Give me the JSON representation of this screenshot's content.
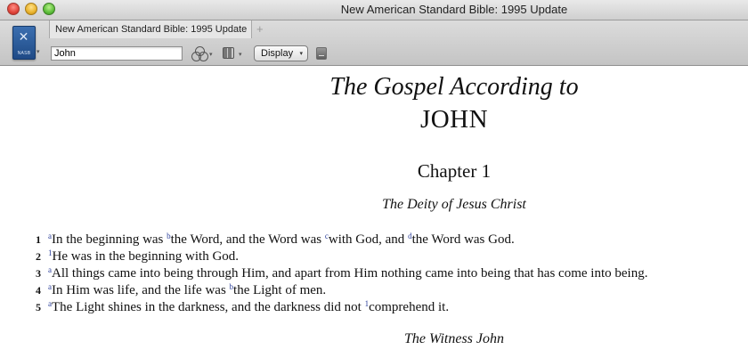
{
  "window": {
    "title": "New American Standard Bible: 1995 Update"
  },
  "toolbar": {
    "book_icon_abbr": "NASB",
    "tab_label": "New American Standard Bible: 1995 Update",
    "tab_add": "+",
    "reference_value": "John",
    "display_label": "Display",
    "caret": "▾"
  },
  "content": {
    "subtitle": "The Gospel According to",
    "book_title": "JOHN",
    "chapter": "Chapter 1",
    "section_heading": "The Deity of Jesus Christ",
    "next_heading": "The Witness John",
    "verses": [
      {
        "num": "1",
        "parts": [
          {
            "fn": "a"
          },
          {
            "text": "In the beginning was "
          },
          {
            "fn": "b"
          },
          {
            "text": "the Word, and the Word was "
          },
          {
            "fn": "c"
          },
          {
            "text": "with God, and "
          },
          {
            "fn": "d"
          },
          {
            "text": "the Word was God."
          }
        ]
      },
      {
        "num": "2",
        "parts": [
          {
            "fn": "1"
          },
          {
            "text": "He was in the beginning with God."
          }
        ]
      },
      {
        "num": "3",
        "parts": [
          {
            "fn": "a"
          },
          {
            "text": "All things came into being through Him, and apart from Him nothing came into being that has come into being."
          }
        ]
      },
      {
        "num": "4",
        "parts": [
          {
            "fn": "a"
          },
          {
            "text": "In Him was life, and the life was "
          },
          {
            "fn": "b"
          },
          {
            "text": "the Light of men."
          }
        ]
      },
      {
        "num": "5",
        "parts": [
          {
            "fn": "a"
          },
          {
            "text": "The Light shines in the darkness, and the darkness did not "
          },
          {
            "fn": "1"
          },
          {
            "text": "comprehend it."
          }
        ]
      }
    ]
  },
  "icons": {
    "close": "close-icon",
    "minimize": "minimize-icon",
    "zoom": "zoom-icon",
    "book": "bible-book-icon",
    "parallel": "parallel-resources-icon",
    "layout": "column-layout-icon",
    "notes": "notes-icon"
  },
  "colors": {
    "footnote": "#2a3e9a",
    "book_icon": "#2c5a9a"
  }
}
